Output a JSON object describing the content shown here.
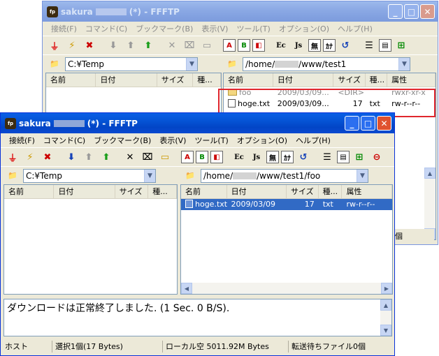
{
  "colors": {
    "highlight": "#e0262d",
    "title_active": "#0553d4",
    "title_inactive": "#8aa8e4",
    "selection": "#316ac5"
  },
  "back_window": {
    "title_host": "sakura",
    "title_suffix": "(*) - FFFTP",
    "menu": [
      "接続(F)",
      "コマンド(C)",
      "ブックマーク(B)",
      "表示(V)",
      "ツール(T)",
      "オプション(O)",
      "ヘルプ(H)"
    ],
    "local_path": "C:¥Temp",
    "remote_path_prefix": "/home/",
    "remote_path_suffix": "/www/test1",
    "columns": {
      "name": "名前",
      "date": "日付",
      "size": "サイズ",
      "type": "種...",
      "attr": "属性"
    },
    "remote_files": [
      {
        "name": "foo",
        "date": "2009/03/09...",
        "size": "<DIR>",
        "type": "",
        "attr": "rwxr-xr-x"
      },
      {
        "name": "hoge.txt",
        "date": "2009/03/09...",
        "size": "17",
        "type": "txt",
        "attr": "rw-r--r--"
      }
    ],
    "partial_status": "個"
  },
  "front_window": {
    "title_host": "sakura",
    "title_suffix": "(*) - FFFTP",
    "menu": [
      "接続(F)",
      "コマンド(C)",
      "ブックマーク(B)",
      "表示(V)",
      "ツール(T)",
      "オプション(O)",
      "ヘルプ(H)"
    ],
    "toolbar_text": {
      "ascii": "A",
      "binary": "B",
      "kanji_euc": "Ec",
      "kanji_jis": "Js",
      "no_conv": "無",
      "kana": "ｶﾅ"
    },
    "local_path": "C:¥Temp",
    "remote_path_prefix": "/home/",
    "remote_path_suffix": "/www/test1/foo",
    "columns": {
      "name": "名前",
      "date": "日付",
      "size": "サイズ",
      "type": "種...",
      "attr": "属性"
    },
    "remote_files": [
      {
        "name": "hoge.txt",
        "date": "2009/03/09",
        "size": "17",
        "type": "txt",
        "attr": "rw-r--r--",
        "selected": true
      }
    ],
    "log_message": "ダウンロードは正常終了しました. (1 Sec. 0 B/S).",
    "status": {
      "host": "ホスト",
      "selection": "選択1個(17 Bytes)",
      "local_free": "ローカル空 5011.92M Bytes",
      "queue": "転送待ちファイル0個"
    }
  }
}
